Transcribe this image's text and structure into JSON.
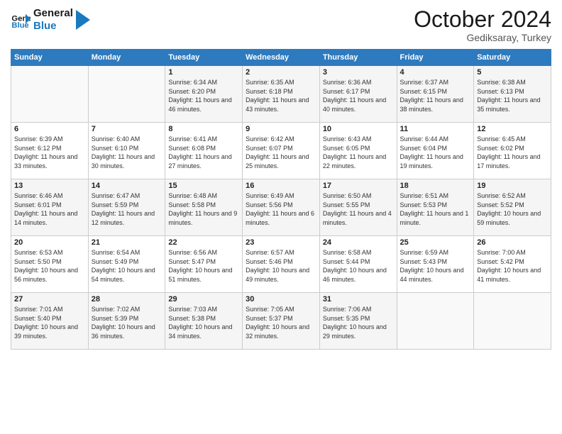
{
  "logo": {
    "line1": "General",
    "line2": "Blue"
  },
  "title": "October 2024",
  "subtitle": "Gediksaray, Turkey",
  "days_of_week": [
    "Sunday",
    "Monday",
    "Tuesday",
    "Wednesday",
    "Thursday",
    "Friday",
    "Saturday"
  ],
  "weeks": [
    [
      {
        "day": "",
        "sunrise": "",
        "sunset": "",
        "daylight": ""
      },
      {
        "day": "",
        "sunrise": "",
        "sunset": "",
        "daylight": ""
      },
      {
        "day": "1",
        "sunrise": "Sunrise: 6:34 AM",
        "sunset": "Sunset: 6:20 PM",
        "daylight": "Daylight: 11 hours and 46 minutes."
      },
      {
        "day": "2",
        "sunrise": "Sunrise: 6:35 AM",
        "sunset": "Sunset: 6:18 PM",
        "daylight": "Daylight: 11 hours and 43 minutes."
      },
      {
        "day": "3",
        "sunrise": "Sunrise: 6:36 AM",
        "sunset": "Sunset: 6:17 PM",
        "daylight": "Daylight: 11 hours and 40 minutes."
      },
      {
        "day": "4",
        "sunrise": "Sunrise: 6:37 AM",
        "sunset": "Sunset: 6:15 PM",
        "daylight": "Daylight: 11 hours and 38 minutes."
      },
      {
        "day": "5",
        "sunrise": "Sunrise: 6:38 AM",
        "sunset": "Sunset: 6:13 PM",
        "daylight": "Daylight: 11 hours and 35 minutes."
      }
    ],
    [
      {
        "day": "6",
        "sunrise": "Sunrise: 6:39 AM",
        "sunset": "Sunset: 6:12 PM",
        "daylight": "Daylight: 11 hours and 33 minutes."
      },
      {
        "day": "7",
        "sunrise": "Sunrise: 6:40 AM",
        "sunset": "Sunset: 6:10 PM",
        "daylight": "Daylight: 11 hours and 30 minutes."
      },
      {
        "day": "8",
        "sunrise": "Sunrise: 6:41 AM",
        "sunset": "Sunset: 6:08 PM",
        "daylight": "Daylight: 11 hours and 27 minutes."
      },
      {
        "day": "9",
        "sunrise": "Sunrise: 6:42 AM",
        "sunset": "Sunset: 6:07 PM",
        "daylight": "Daylight: 11 hours and 25 minutes."
      },
      {
        "day": "10",
        "sunrise": "Sunrise: 6:43 AM",
        "sunset": "Sunset: 6:05 PM",
        "daylight": "Daylight: 11 hours and 22 minutes."
      },
      {
        "day": "11",
        "sunrise": "Sunrise: 6:44 AM",
        "sunset": "Sunset: 6:04 PM",
        "daylight": "Daylight: 11 hours and 19 minutes."
      },
      {
        "day": "12",
        "sunrise": "Sunrise: 6:45 AM",
        "sunset": "Sunset: 6:02 PM",
        "daylight": "Daylight: 11 hours and 17 minutes."
      }
    ],
    [
      {
        "day": "13",
        "sunrise": "Sunrise: 6:46 AM",
        "sunset": "Sunset: 6:01 PM",
        "daylight": "Daylight: 11 hours and 14 minutes."
      },
      {
        "day": "14",
        "sunrise": "Sunrise: 6:47 AM",
        "sunset": "Sunset: 5:59 PM",
        "daylight": "Daylight: 11 hours and 12 minutes."
      },
      {
        "day": "15",
        "sunrise": "Sunrise: 6:48 AM",
        "sunset": "Sunset: 5:58 PM",
        "daylight": "Daylight: 11 hours and 9 minutes."
      },
      {
        "day": "16",
        "sunrise": "Sunrise: 6:49 AM",
        "sunset": "Sunset: 5:56 PM",
        "daylight": "Daylight: 11 hours and 6 minutes."
      },
      {
        "day": "17",
        "sunrise": "Sunrise: 6:50 AM",
        "sunset": "Sunset: 5:55 PM",
        "daylight": "Daylight: 11 hours and 4 minutes."
      },
      {
        "day": "18",
        "sunrise": "Sunrise: 6:51 AM",
        "sunset": "Sunset: 5:53 PM",
        "daylight": "Daylight: 11 hours and 1 minute."
      },
      {
        "day": "19",
        "sunrise": "Sunrise: 6:52 AM",
        "sunset": "Sunset: 5:52 PM",
        "daylight": "Daylight: 10 hours and 59 minutes."
      }
    ],
    [
      {
        "day": "20",
        "sunrise": "Sunrise: 6:53 AM",
        "sunset": "Sunset: 5:50 PM",
        "daylight": "Daylight: 10 hours and 56 minutes."
      },
      {
        "day": "21",
        "sunrise": "Sunrise: 6:54 AM",
        "sunset": "Sunset: 5:49 PM",
        "daylight": "Daylight: 10 hours and 54 minutes."
      },
      {
        "day": "22",
        "sunrise": "Sunrise: 6:56 AM",
        "sunset": "Sunset: 5:47 PM",
        "daylight": "Daylight: 10 hours and 51 minutes."
      },
      {
        "day": "23",
        "sunrise": "Sunrise: 6:57 AM",
        "sunset": "Sunset: 5:46 PM",
        "daylight": "Daylight: 10 hours and 49 minutes."
      },
      {
        "day": "24",
        "sunrise": "Sunrise: 6:58 AM",
        "sunset": "Sunset: 5:44 PM",
        "daylight": "Daylight: 10 hours and 46 minutes."
      },
      {
        "day": "25",
        "sunrise": "Sunrise: 6:59 AM",
        "sunset": "Sunset: 5:43 PM",
        "daylight": "Daylight: 10 hours and 44 minutes."
      },
      {
        "day": "26",
        "sunrise": "Sunrise: 7:00 AM",
        "sunset": "Sunset: 5:42 PM",
        "daylight": "Daylight: 10 hours and 41 minutes."
      }
    ],
    [
      {
        "day": "27",
        "sunrise": "Sunrise: 7:01 AM",
        "sunset": "Sunset: 5:40 PM",
        "daylight": "Daylight: 10 hours and 39 minutes."
      },
      {
        "day": "28",
        "sunrise": "Sunrise: 7:02 AM",
        "sunset": "Sunset: 5:39 PM",
        "daylight": "Daylight: 10 hours and 36 minutes."
      },
      {
        "day": "29",
        "sunrise": "Sunrise: 7:03 AM",
        "sunset": "Sunset: 5:38 PM",
        "daylight": "Daylight: 10 hours and 34 minutes."
      },
      {
        "day": "30",
        "sunrise": "Sunrise: 7:05 AM",
        "sunset": "Sunset: 5:37 PM",
        "daylight": "Daylight: 10 hours and 32 minutes."
      },
      {
        "day": "31",
        "sunrise": "Sunrise: 7:06 AM",
        "sunset": "Sunset: 5:35 PM",
        "daylight": "Daylight: 10 hours and 29 minutes."
      },
      {
        "day": "",
        "sunrise": "",
        "sunset": "",
        "daylight": ""
      },
      {
        "day": "",
        "sunrise": "",
        "sunset": "",
        "daylight": ""
      }
    ]
  ]
}
